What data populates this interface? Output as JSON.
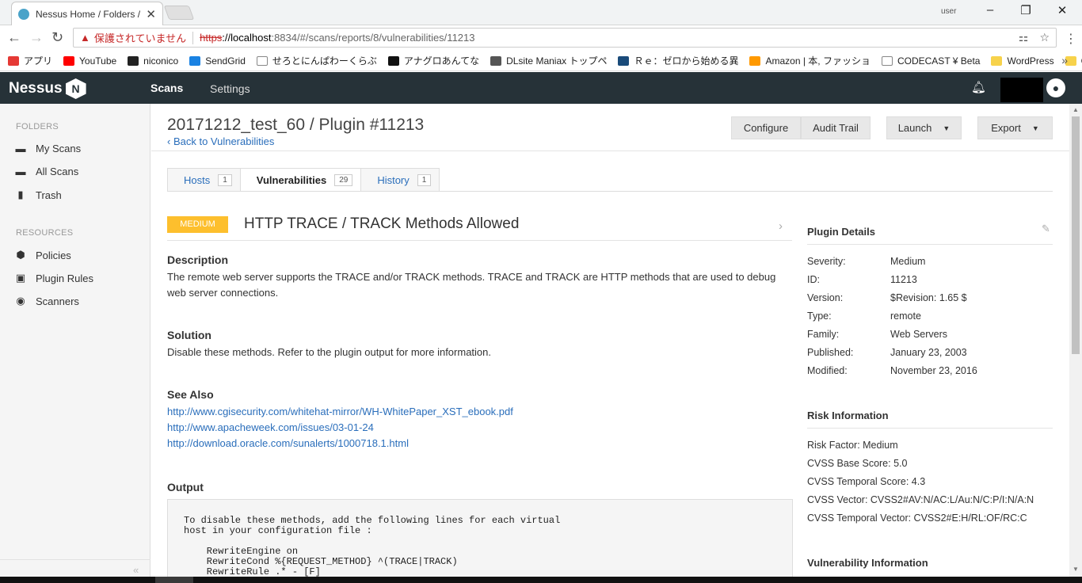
{
  "browser": {
    "tab_title": "Nessus Home / Folders /",
    "user_label": "user",
    "insecure_label": "保護されていません",
    "url_scheme": "https",
    "url_host": "://localhost",
    "url_path": ":8834/#/scans/reports/8/vulnerabilities/11213",
    "bookmarks": [
      {
        "label": "アプリ",
        "color": "#e53935"
      },
      {
        "label": "YouTube",
        "color": "#ff0000"
      },
      {
        "label": "niconico",
        "color": "#222222"
      },
      {
        "label": "SendGrid",
        "color": "#1a82e2"
      },
      {
        "label": "せろとにんぱわーくらぶ",
        "color": "#ffffff"
      },
      {
        "label": "アナグロあんてな",
        "color": "#111111"
      },
      {
        "label": "DLsite Maniax トップペ",
        "color": "#555555"
      },
      {
        "label": "Ｒｅ：ゼロから始める異",
        "color": "#1a4b7a"
      },
      {
        "label": "Amazon | 本, ファッショ",
        "color": "#ff9900"
      },
      {
        "label": "CODECAST ¥ Beta",
        "color": "#ffffff"
      },
      {
        "label": "WordPress",
        "color": "#f7d24b"
      },
      {
        "label": "CentOS",
        "color": "#f7d24b"
      }
    ]
  },
  "app": {
    "logo": "Nessus",
    "logo_badge": "N",
    "nav_scans": "Scans",
    "nav_settings": "Settings"
  },
  "sidebar": {
    "folders_heading": "FOLDERS",
    "resources_heading": "RESOURCES",
    "folders": [
      {
        "label": "My Scans",
        "icon": "folder-icon"
      },
      {
        "label": "All Scans",
        "icon": "folder-icon"
      },
      {
        "label": "Trash",
        "icon": "trash-icon"
      }
    ],
    "resources": [
      {
        "label": "Policies",
        "icon": "policy-icon"
      },
      {
        "label": "Plugin Rules",
        "icon": "plugin-rules-icon"
      },
      {
        "label": "Scanners",
        "icon": "scanner-icon"
      }
    ]
  },
  "page": {
    "title": "20171212_test_60 / Plugin #11213",
    "back_link": "Back to Vulnerabilities",
    "buttons": {
      "configure": "Configure",
      "audit_trail": "Audit Trail",
      "launch": "Launch",
      "export": "Export"
    },
    "tabs": [
      {
        "label": "Hosts",
        "count": "1"
      },
      {
        "label": "Vulnerabilities",
        "count": "29"
      },
      {
        "label": "History",
        "count": "1"
      }
    ]
  },
  "vuln": {
    "severity": "MEDIUM",
    "severity_color": "#fdbf2d",
    "title": "HTTP TRACE / TRACK Methods Allowed",
    "description_heading": "Description",
    "description": "The remote web server supports the TRACE and/or TRACK methods. TRACE and TRACK are HTTP methods that are used to debug web server connections.",
    "solution_heading": "Solution",
    "solution": "Disable these methods. Refer to the plugin output for more information.",
    "see_also_heading": "See Also",
    "see_also": [
      "http://www.cgisecurity.com/whitehat-mirror/WH-WhitePaper_XST_ebook.pdf",
      "http://www.apacheweek.com/issues/03-01-24",
      "http://download.oracle.com/sunalerts/1000718.1.html"
    ],
    "output_heading": "Output",
    "output_text": "To disable these methods, add the following lines for each virtual\nhost in your configuration file :\n\n    RewriteEngine on\n    RewriteCond %{REQUEST_METHOD} ^(TRACE|TRACK)\n    RewriteRule .* - [F]"
  },
  "plugin_details": {
    "heading": "Plugin Details",
    "rows": [
      {
        "k": "Severity:",
        "v": "Medium"
      },
      {
        "k": "ID:",
        "v": "11213"
      },
      {
        "k": "Version:",
        "v": "$Revision: 1.65 $"
      },
      {
        "k": "Type:",
        "v": "remote"
      },
      {
        "k": "Family:",
        "v": "Web Servers"
      },
      {
        "k": "Published:",
        "v": "January 23, 2003"
      },
      {
        "k": "Modified:",
        "v": "November 23, 2016"
      }
    ]
  },
  "risk_information": {
    "heading": "Risk Information",
    "rows": [
      "Risk Factor: Medium",
      "CVSS Base Score: 5.0",
      "CVSS Temporal Score: 4.3",
      "CVSS Vector: CVSS2#AV:N/AC:L/Au:N/C:P/I:N/A:N",
      "CVSS Temporal Vector: CVSS2#E:H/RL:OF/RC:C"
    ]
  },
  "vulnerability_information": {
    "heading": "Vulnerability Information"
  }
}
